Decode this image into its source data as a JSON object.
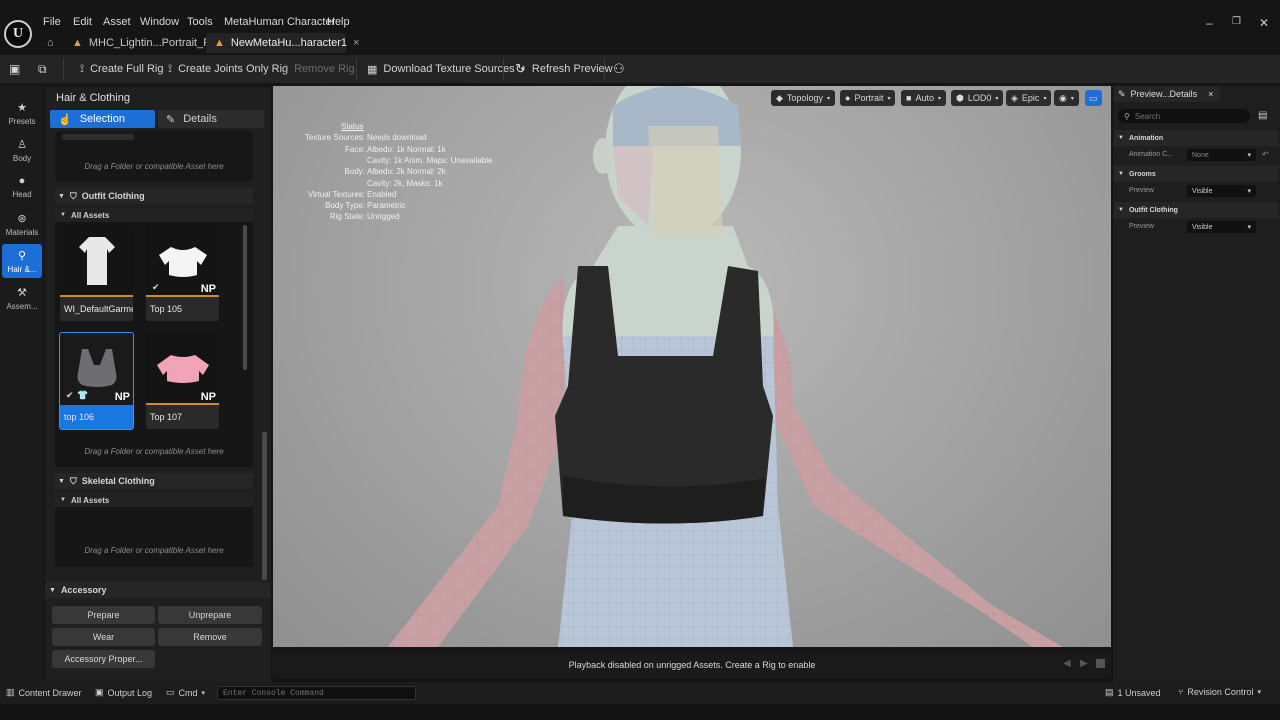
{
  "menu": [
    "File",
    "Edit",
    "Asset",
    "Window",
    "Tools",
    "MetaHuman Character",
    "Help"
  ],
  "tabs": [
    {
      "label": "MHC_Lightin...Portrait_RT"
    },
    {
      "label": "NewMetaHu...haracter1"
    }
  ],
  "toolbar": {
    "create_full_rig": "Create Full Rig",
    "create_joints_only_rig": "Create Joints Only Rig",
    "remove_rig": "Remove Rig",
    "download_texture_sources": "Download Texture Sources",
    "refresh_preview": "Refresh Preview"
  },
  "rail": [
    {
      "label": "Presets",
      "icon": "star-icon"
    },
    {
      "label": "Body",
      "icon": "body-icon"
    },
    {
      "label": "Head",
      "icon": "head-icon"
    },
    {
      "label": "Materials",
      "icon": "materials-icon"
    },
    {
      "label": "Hair &...",
      "icon": "hair-icon"
    },
    {
      "label": "Assem...",
      "icon": "hammer-icon"
    }
  ],
  "left_panel": {
    "title": "Hair & Clothing",
    "selection_label": "Selection",
    "details_label": "Details",
    "drop_hint": "Drag a Folder or compatible Asset here",
    "outfit_clothing": "Outfit Clothing",
    "all_assets": "All Assets",
    "assets": [
      {
        "label": "WI_DefaultGarment"
      },
      {
        "label": "Top 105",
        "badge": "NP"
      },
      {
        "label": "top 106",
        "badge": "NP"
      },
      {
        "label": "Top 107",
        "badge": "NP"
      }
    ],
    "skeletal_clothing": "Skeletal Clothing",
    "accessory": "Accessory",
    "prepare": "Prepare",
    "unprepare": "Unprepare",
    "wear": "Wear",
    "remove": "Remove",
    "accessory_properties": "Accessory Proper..."
  },
  "viewport": {
    "topology": "Topology",
    "portrait": "Portrait",
    "auto": "Auto",
    "lod": "LOD0",
    "epic": "Epic",
    "status_title": "Status",
    "status_rows": [
      {
        "k": "Texture Sources:",
        "v": "Needs download"
      },
      {
        "k": "Face:",
        "v": "Albedo: 1k Normal: 1k"
      },
      {
        "k": "",
        "v": "Cavity: 1k  Anim. Maps: Unavailable"
      },
      {
        "k": "Body:",
        "v": "Albedo: 2k Normal: 2k"
      },
      {
        "k": "",
        "v": "Cavity: 2k, Masks: 1k"
      },
      {
        "k": "Virtual Textures:",
        "v": "Enabled"
      },
      {
        "k": "Body Type:",
        "v": "Parametric"
      },
      {
        "k": "Rig State:",
        "v": "Unrigged"
      }
    ],
    "playback_msg": "Playback disabled on unrigged Assets. Create a Rig to enable"
  },
  "right_panel": {
    "tab": "Preview...Details",
    "search_placeholder": "Search",
    "animation": "Animation",
    "animation_prop": "Animation C...",
    "animation_value": "None",
    "grooms": "Grooms",
    "outfit_clothing": "Outfit Clothing",
    "preview": "Preview",
    "visible": "Visible"
  },
  "statusbar": {
    "content_drawer": "Content Drawer",
    "output_log": "Output Log",
    "cmd": "Cmd",
    "console_placeholder": "Enter Console Command",
    "unsaved": "1 Unsaved",
    "revision_control": "Revision Control"
  },
  "colors": {
    "accent": "#1d6fd6",
    "asset_underline": "#d08a2e"
  }
}
